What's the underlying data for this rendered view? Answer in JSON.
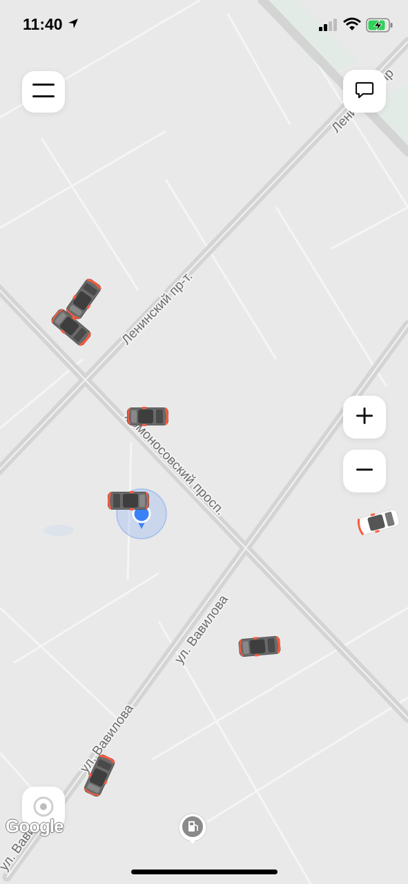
{
  "status_bar": {
    "time": "11:40",
    "icons": [
      "location-arrow-icon",
      "cellular-signal-icon",
      "wifi-icon",
      "battery-charging-icon"
    ],
    "battery_color": "#30d158"
  },
  "map": {
    "street_labels": {
      "leninsky_main": "Ленинский пр-т.",
      "leninsky_top": "Ленинский пр",
      "lomonosovsky": "Ломоносовский просп.",
      "vavilova_1": "ул. Вавилова",
      "vavilova_2": "ул. Вавилова",
      "vavilova_3": "ул. Вавил"
    },
    "attribution": "Google",
    "accent_color": "#3b82f6",
    "car_accent_color": "#ff5a3c"
  },
  "controls": {
    "menu_icon": "hamburger-menu-icon",
    "chat_icon": "chat-bubble-icon",
    "zoom_in_icon": "plus-icon",
    "zoom_out_icon": "minus-icon",
    "locate_icon": "my-location-icon",
    "poi_icon": "gas-station-icon"
  }
}
